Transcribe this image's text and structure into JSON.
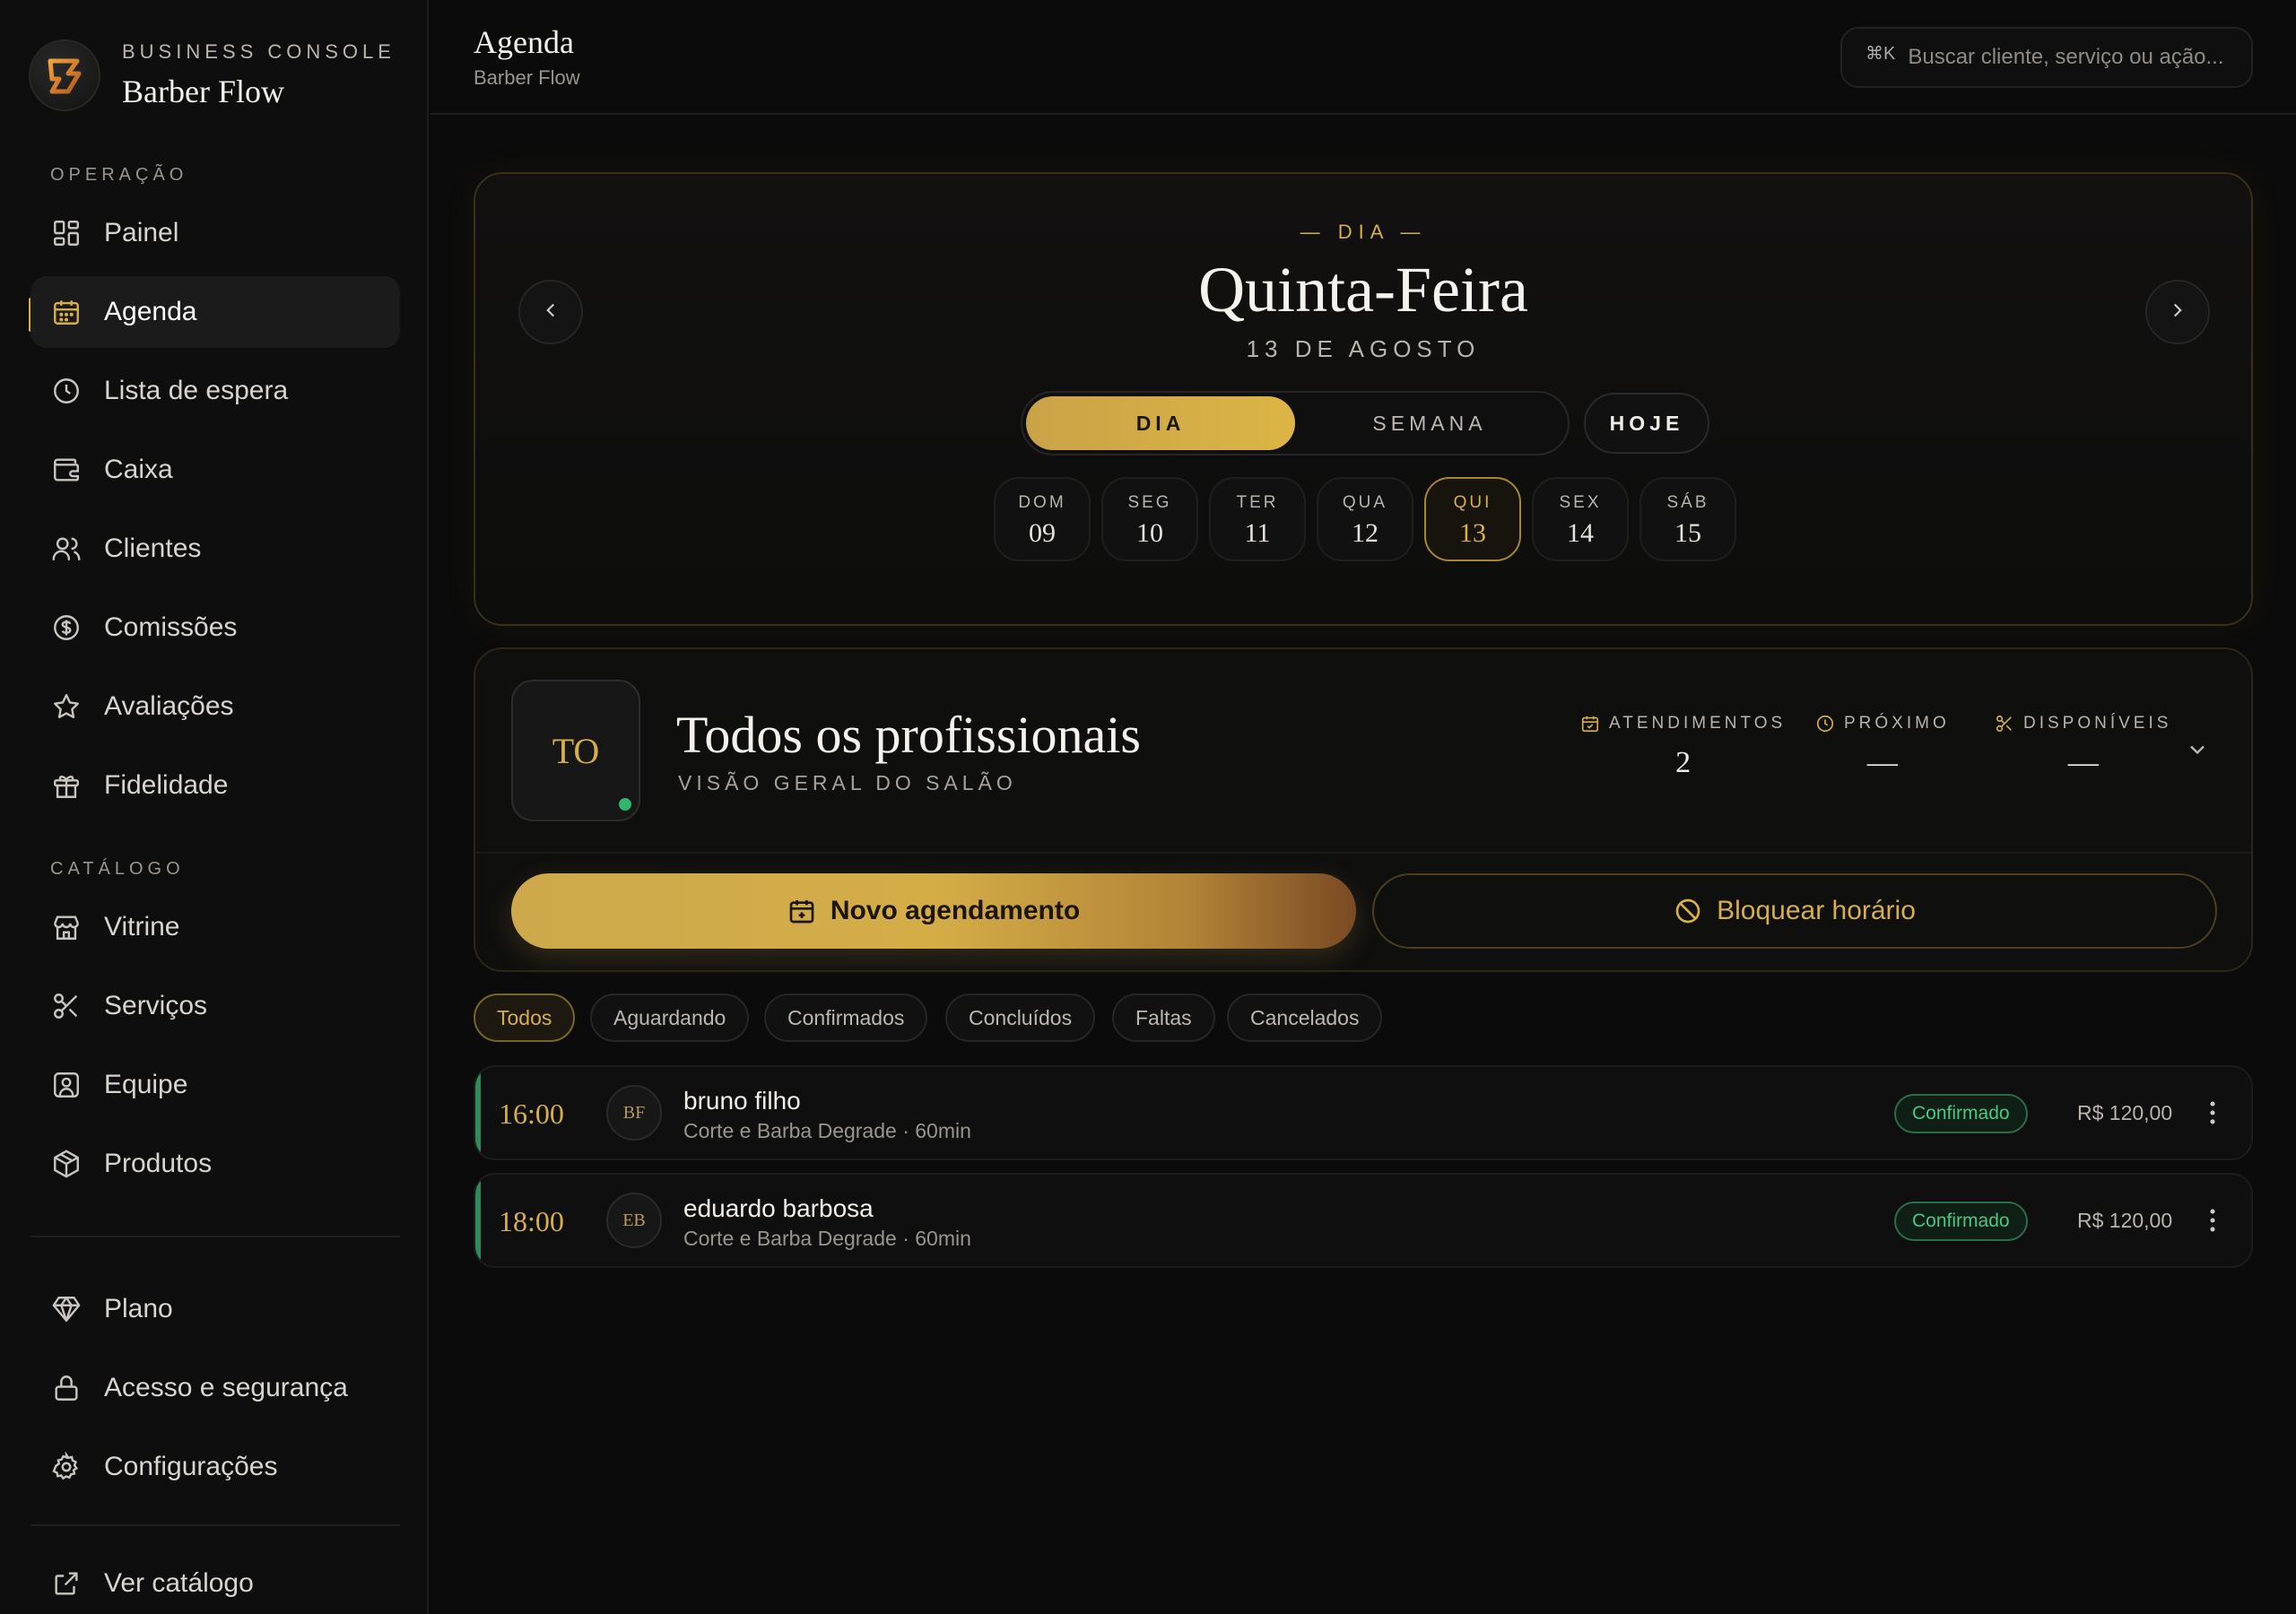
{
  "brand": {
    "eyebrow": "BUSINESS CONSOLE",
    "name": "Barber Flow",
    "accent": "#d6ae4c"
  },
  "sidebar": {
    "section_operacao": "OPERAÇÃO",
    "section_catalogo": "CATÁLOGO",
    "items": [
      {
        "label": "Painel",
        "icon": "grid-icon"
      },
      {
        "label": "Agenda",
        "icon": "calendar-icon",
        "active": true
      },
      {
        "label": "Lista de espera",
        "icon": "clock-icon"
      },
      {
        "label": "Caixa",
        "icon": "wallet-icon"
      },
      {
        "label": "Clientes",
        "icon": "users-icon"
      },
      {
        "label": "Comissões",
        "icon": "dollar-circle-icon"
      },
      {
        "label": "Avaliações",
        "icon": "star-icon"
      },
      {
        "label": "Fidelidade",
        "icon": "gift-icon"
      }
    ],
    "catalog_items": [
      {
        "label": "Vitrine",
        "icon": "store-icon"
      },
      {
        "label": "Serviços",
        "icon": "scissors-icon"
      },
      {
        "label": "Equipe",
        "icon": "user-square-icon"
      },
      {
        "label": "Produtos",
        "icon": "box-icon"
      }
    ],
    "bottom_items": [
      {
        "label": "Plano",
        "icon": "diamond-icon"
      },
      {
        "label": "Acesso e segurança",
        "icon": "lock-icon"
      },
      {
        "label": "Configurações",
        "icon": "gear-icon"
      }
    ],
    "footer_link": {
      "label": "Ver catálogo",
      "icon": "external-link-icon"
    }
  },
  "header": {
    "title": "Agenda",
    "subtitle": "Barber Flow",
    "search_shortcut": "⌘K",
    "search_placeholder": "Buscar cliente, serviço ou ação..."
  },
  "day": {
    "eyebrow": "— DIA —",
    "weekday_title": "Quinta-Feira",
    "date": "13 DE AGOSTO",
    "view_day": "DIA",
    "view_week": "SEMANA",
    "today": "HOJE",
    "week": [
      {
        "d": "DOM",
        "n": "09"
      },
      {
        "d": "SEG",
        "n": "10"
      },
      {
        "d": "TER",
        "n": "11"
      },
      {
        "d": "QUA",
        "n": "12"
      },
      {
        "d": "QUI",
        "n": "13",
        "selected": true
      },
      {
        "d": "SEX",
        "n": "14"
      },
      {
        "d": "SÁB",
        "n": "15"
      }
    ]
  },
  "professional": {
    "initials": "TO",
    "name": "Todos os profissionais",
    "subtitle": "VISÃO GERAL DO SALÃO",
    "stats": [
      {
        "label": "ATENDIMENTOS",
        "value": "2",
        "icon": "calendar-check-icon"
      },
      {
        "label": "PRÓXIMO",
        "value": "—",
        "icon": "clock-icon"
      },
      {
        "label": "DISPONÍVEIS",
        "value": "—",
        "icon": "scissors-icon"
      }
    ],
    "new_button": "Novo agendamento",
    "block_button": "Bloquear horário"
  },
  "filters": [
    "Todos",
    "Aguardando",
    "Confirmados",
    "Concluídos",
    "Faltas",
    "Cancelados"
  ],
  "appointments": [
    {
      "time": "16:00",
      "initials": "BF",
      "client": "bruno filho",
      "service": "Corte e Barba Degrade · 60min",
      "status": "Confirmado",
      "price": "R$ 120,00"
    },
    {
      "time": "18:00",
      "initials": "EB",
      "client": "eduardo barbosa",
      "service": "Corte e Barba Degrade · 60min",
      "status": "Confirmado",
      "price": "R$ 120,00"
    }
  ],
  "colors": {
    "accent_gold": "#d6ae4c",
    "status_green": "#4cc684",
    "background": "#0b0b0b"
  }
}
